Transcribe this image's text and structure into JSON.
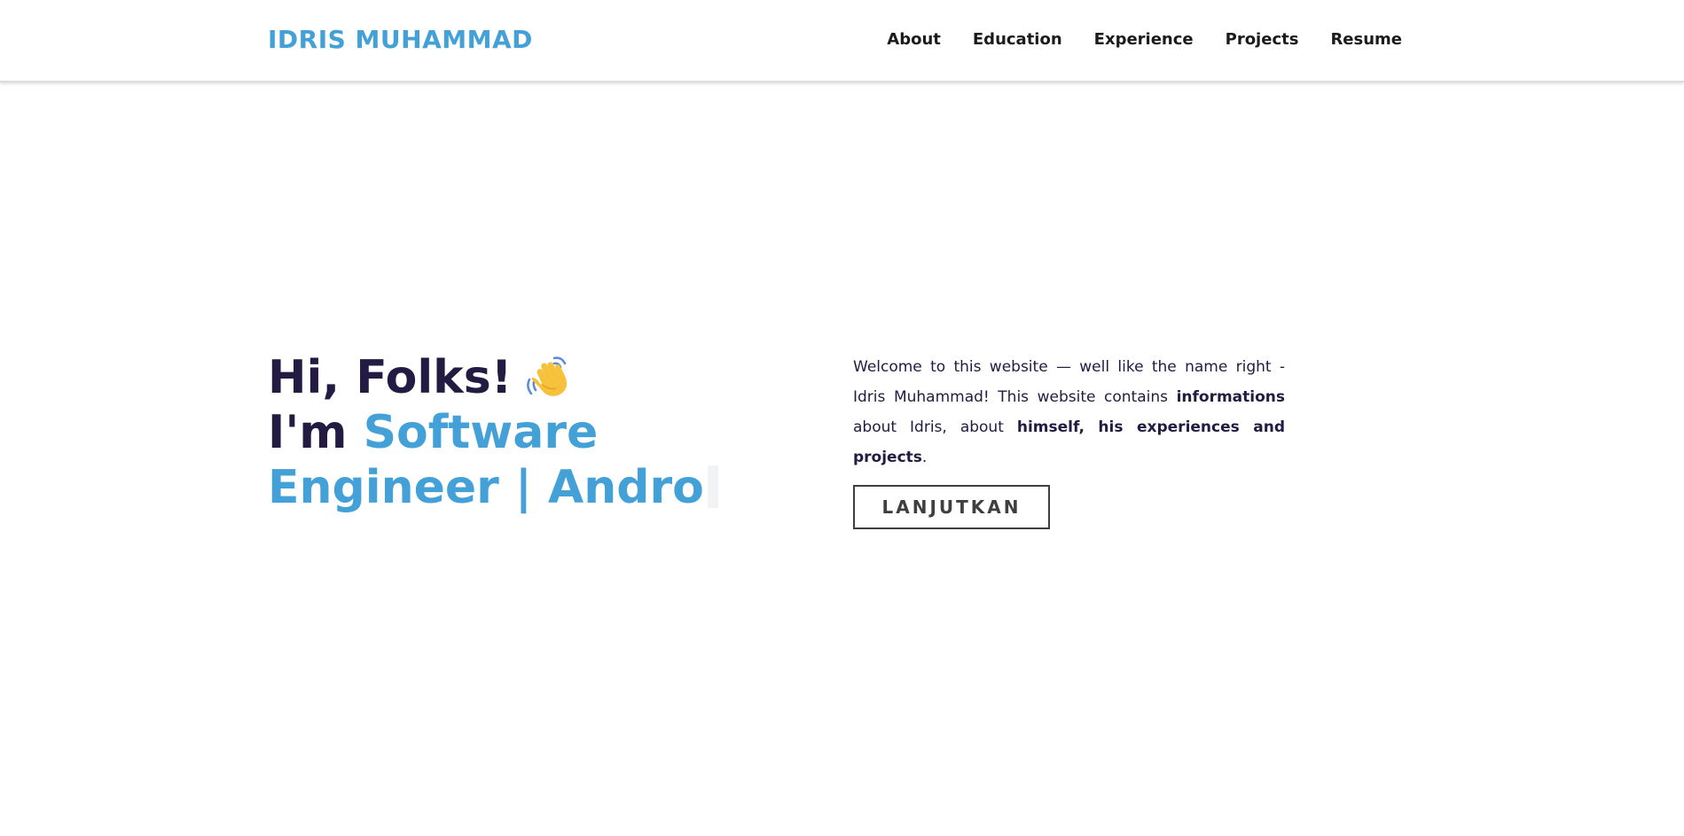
{
  "header": {
    "brand": "IDRIS MUHAMMAD",
    "nav": [
      {
        "label": "About"
      },
      {
        "label": "Education"
      },
      {
        "label": "Experience"
      },
      {
        "label": "Projects"
      },
      {
        "label": "Resume"
      }
    ]
  },
  "hero": {
    "greeting": "Hi, Folks!",
    "greeting_icon": "waving-hand-icon",
    "role_prefix": "I'm ",
    "role_typed_text": "Software Engineer | Andro",
    "description": {
      "part1": "Welcome to this website — well like the name right - Idris Muhammad! This website contains ",
      "bold1": "informations",
      "part2": " about Idris, about ",
      "bold2": "himself, his experiences and projects",
      "part3": "."
    },
    "cta_label": "LANJUTKAN"
  },
  "colors": {
    "accent": "#43a1d7",
    "text_dark": "#231b42",
    "button_border": "#3f3f3f"
  }
}
